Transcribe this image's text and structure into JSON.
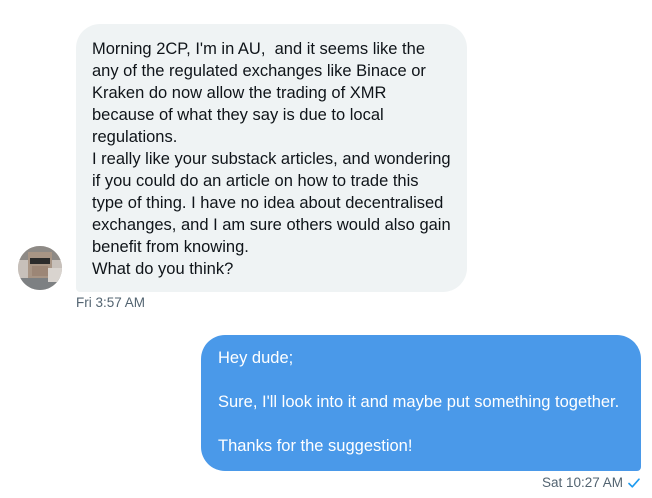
{
  "conversation": {
    "incoming": {
      "text": "Morning 2CP, I'm in AU,  and it seems like the any of the regulated exchanges like Binace or Kraken do now allow the trading of XMR because of what they say is due to local regulations.\nI really like your substack articles, and wondering if you could do an article on how to trade this type of thing. I have no idea about decentralised exchanges, and I am sure others would also gain benefit from knowing.\nWhat do you think?",
      "timestamp": "Fri 3:57 AM"
    },
    "outgoing": {
      "text": "Hey dude;\n\nSure, I'll look into it and maybe put something together.\n\nThanks for the suggestion!",
      "timestamp": "Sat 10:27 AM",
      "status_icon": "check-icon"
    }
  },
  "colors": {
    "incoming_bubble": "#eff3f4",
    "outgoing_bubble": "#4a99e9",
    "timestamp": "#536471",
    "read_check": "#1d9bf0"
  }
}
